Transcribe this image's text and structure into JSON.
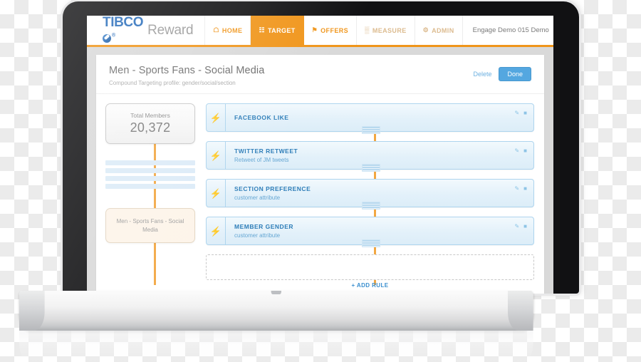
{
  "brand": {
    "name": "TIBCO",
    "registered": "®",
    "product": "Reward"
  },
  "nav": {
    "items": [
      {
        "label": "HOME",
        "icon": "home-icon",
        "glyph": "⌂",
        "active": false
      },
      {
        "label": "TARGET",
        "icon": "target-icon",
        "glyph": "☷",
        "active": true
      },
      {
        "label": "OFFERS",
        "icon": "tag-icon",
        "glyph": "⚑",
        "active": false
      },
      {
        "label": "MEASURE",
        "icon": "chart-icon",
        "glyph": "▒",
        "active": false
      },
      {
        "label": "ADMIN",
        "icon": "gear-icon",
        "glyph": "⚙",
        "active": false
      }
    ],
    "account": "Engage Demo 015 Demo"
  },
  "header": {
    "title": "Men - Sports Fans - Social Media",
    "subtitle": "Compound Targeting profile: gender/social/section",
    "delete_label": "Delete",
    "done_label": "Done"
  },
  "summary": {
    "total_members_label": "Total Members",
    "total_members_value": "20,372",
    "skeleton_rows": 4,
    "group_name": "Men - Sports Fans - Social Media"
  },
  "rules": [
    {
      "title": "FACEBOOK LIKE",
      "subtitle": "",
      "icon": "lightning-bolt-icon"
    },
    {
      "title": "TWITTER RETWEET",
      "subtitle": "Retweet of JM tweets",
      "icon": "lightning-bolt-icon"
    },
    {
      "title": "SECTION PREFERENCE",
      "subtitle": "customer attribute",
      "icon": "lightning-bolt-icon"
    },
    {
      "title": "MEMBER GENDER",
      "subtitle": "customer attribute",
      "icon": "lightning-bolt-icon"
    }
  ],
  "dropzone": {
    "label": "+ ADD RULE"
  },
  "icons": {
    "edit": "✎",
    "trash": "Ὕ1",
    "bolt": "⚡"
  },
  "colors": {
    "accent_orange": "#f0951a",
    "connector_orange": "#f2a742",
    "brand_blue": "#2a6ebb",
    "rule_blue": "#2d7db8",
    "button_blue": "#54a7e0",
    "group_cream": "#fdf4e9"
  }
}
